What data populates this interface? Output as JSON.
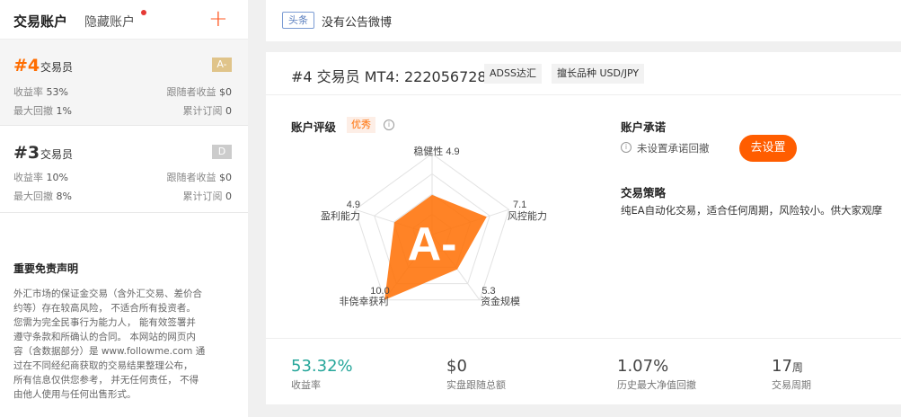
{
  "sidebar": {
    "tab_active": "交易账户",
    "tab_hidden": "隐藏账户",
    "add_symbol": "+",
    "accounts": [
      {
        "num": "#4",
        "role": "交易员",
        "grade": "A-",
        "ror_label": "收益率",
        "ror_value": "53%",
        "follower_label": "跟随者收益",
        "follower_value": "$0",
        "dd_label": "最大回撤",
        "dd_value": "1%",
        "sub_label": "累计订阅",
        "sub_value": "0"
      },
      {
        "num": "#3",
        "role": "交易员",
        "grade": "D",
        "ror_label": "收益率",
        "ror_value": "10%",
        "follower_label": "跟随者收益",
        "follower_value": "$0",
        "dd_label": "最大回撤",
        "dd_value": "8%",
        "sub_label": "累计订阅",
        "sub_value": "0"
      }
    ],
    "disclaimer_title": "重要免责声明",
    "disclaimer_lines": [
      "外汇市场的保证金交易（含外汇交易、差价合",
      "约等）存在较高风险， 不适合所有投资者。",
      "您需为完全民事行为能力人， 能有效签署并",
      "遵守条款和所确认的合同。 本网站的网页内",
      "容（含数据部分）是 www.followme.com 通",
      "过在不同经纪商获取的交易结果整理公布，",
      "所有信息仅供您参考， 并无任何责任， 不得",
      "由他人使用与任何出售形式。"
    ]
  },
  "banner": {
    "tag": "头条",
    "text": "没有公告微博"
  },
  "account": {
    "title": "#4 交易员 MT4: 222056728",
    "broker": "ADSS达汇",
    "specialty": "擅长品种 USD/JPY"
  },
  "rating": {
    "title": "账户评级",
    "badge": "优秀",
    "grade": "A-",
    "axes": [
      {
        "name": "稳健性",
        "value": "4.9"
      },
      {
        "name": "风控能力",
        "value": "7.1"
      },
      {
        "name": "资金规模",
        "value": "5.3"
      },
      {
        "name": "非侥幸获利",
        "value": "10.0"
      },
      {
        "name": "盈利能力",
        "value": "4.9"
      }
    ],
    "max": 10,
    "fill_color": "#ff6d00"
  },
  "commitment": {
    "title": "账户承诺",
    "text": "未设置承诺回撤",
    "button": "去设置"
  },
  "strategy": {
    "title": "交易策略",
    "text": "纯EA自动化交易，适合任何周期，风险较小。供大家观摩"
  },
  "stats": [
    {
      "value": "53.32%",
      "label": "收益率"
    },
    {
      "value": "$0",
      "label": "实盘跟随总额"
    },
    {
      "value": "1.07%",
      "label": "历史最大净值回撤"
    },
    {
      "value": "17",
      "unit": "周",
      "label": "交易周期"
    }
  ]
}
